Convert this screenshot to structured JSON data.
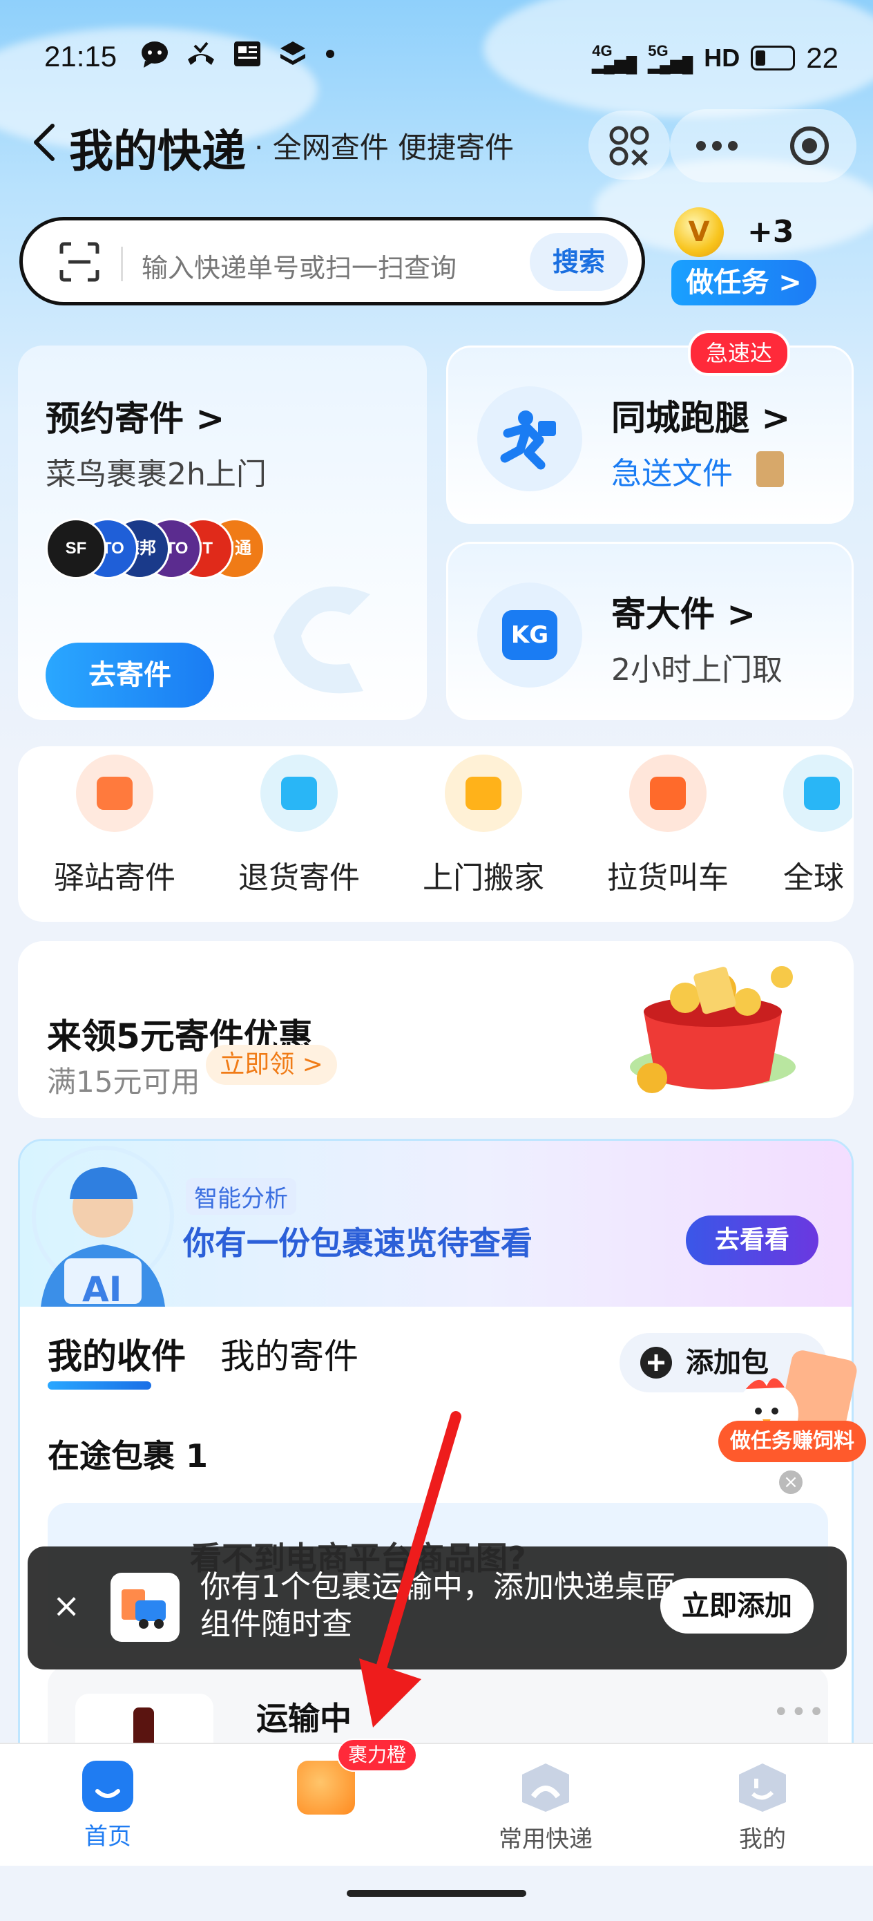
{
  "status_bar": {
    "time": "21:15",
    "icons": [
      "chat-bubble-icon",
      "phone-missed-icon",
      "news-icon",
      "layers-icon",
      "dot-icon"
    ],
    "signal1": "4G",
    "signal2": "5G",
    "hd": "HD",
    "battery": "22"
  },
  "header": {
    "title": "我的快递",
    "subtitle": "· 全网查件 便捷寄件"
  },
  "search": {
    "placeholder": "输入快递单号或扫一扫查询",
    "button": "搜索"
  },
  "task": {
    "plus": "+3",
    "button": "做任务 >",
    "coin": "V"
  },
  "cards": {
    "appointment": {
      "title": "预约寄件 >",
      "subtitle": "菜鸟裹裹2h上门",
      "cta": "去寄件",
      "logos": [
        {
          "text": "SF",
          "color": "#1a1a1a"
        },
        {
          "text": "ZTO",
          "color": "#1f5fd8"
        },
        {
          "text": "德邦",
          "color": "#1a3a8a"
        },
        {
          "text": "YTO",
          "color": "#5b2c8f"
        },
        {
          "text": "JT",
          "color": "#e02a1a"
        },
        {
          "text": "申通",
          "color": "#f07b16"
        }
      ]
    },
    "errand": {
      "badge": "急速达",
      "title": "同城跑腿 >",
      "subtitle": "急送文件"
    },
    "bulky": {
      "title": "寄大件 >",
      "subtitle": "2小时上门取",
      "icon_text": "KG"
    }
  },
  "quick_actions": [
    {
      "label": "驿站寄件",
      "color": "#ff7a3d",
      "bg": "#ffe9de"
    },
    {
      "label": "退货寄件",
      "color": "#29b6f6",
      "bg": "#dff3fc"
    },
    {
      "label": "上门搬家",
      "color": "#ffb21a",
      "bg": "#fff1d6"
    },
    {
      "label": "拉货叫车",
      "color": "#ff6a2b",
      "bg": "#ffe6da"
    },
    {
      "label": "全球",
      "color": "#29b6f6",
      "bg": "#dff3fc"
    }
  ],
  "coupon": {
    "title": "来领5元寄件优惠",
    "subtitle": "满15元可用",
    "button": "立即领 >"
  },
  "ai_card": {
    "tag": "智能分析",
    "message": "你有一份包裹速览待查看",
    "button": "去看看",
    "avatar_text": "AI"
  },
  "tabs": {
    "received": "我的收件",
    "sent": "我的寄件",
    "add": "添加包"
  },
  "floating_widget": {
    "label": "做任务赚饲料"
  },
  "packages": {
    "in_transit_title": "在途包裹 1",
    "behind_text": "看不到电商平台商品图?",
    "item_status": "运输中"
  },
  "toast": {
    "message": "你有1个包裹运输中，添加快递桌面组件随时查",
    "button": "立即添加"
  },
  "bottom_nav": {
    "items": [
      {
        "label": "首页",
        "active": true
      },
      {
        "label": "",
        "badge": "裹力橙"
      },
      {
        "label": "常用快递"
      },
      {
        "label": "我的"
      }
    ]
  }
}
